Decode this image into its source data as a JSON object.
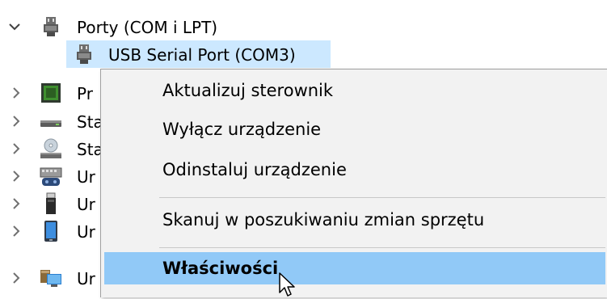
{
  "tree": {
    "ports_category": "Porty (COM i LPT)",
    "selected_device": "USB Serial Port (COM3)",
    "collapsed_items": [
      "Pr",
      "Sta",
      "Sta",
      "Ur",
      "Ur",
      "Ur",
      "Ur"
    ]
  },
  "context_menu": {
    "items": [
      "Aktualizuj sterownik",
      "Wyłącz urządzenie",
      "Odinstaluj urządzenie",
      "Skanuj w poszukiwaniu zmian sprzętu",
      "Właściwości"
    ],
    "highlighted_item": "Właściwości"
  },
  "icons": {
    "expanded_chevron": "chevron-down-icon",
    "collapsed_chevron": "chevron-right-icon",
    "port": "port-connector-icon",
    "processor": "processor-icon",
    "disk": "disk-drive-icon",
    "optical": "optical-drive-icon",
    "hid": "input-device-icon",
    "usb": "usb-device-icon",
    "mobile": "portable-device-icon",
    "system": "system-device-icon",
    "cursor": "mouse-pointer-icon"
  },
  "colors": {
    "selection": "#cce8ff",
    "menu_background": "#f2f2f2",
    "menu_highlight": "#91c9f7",
    "separator": "#c8c8c8"
  }
}
